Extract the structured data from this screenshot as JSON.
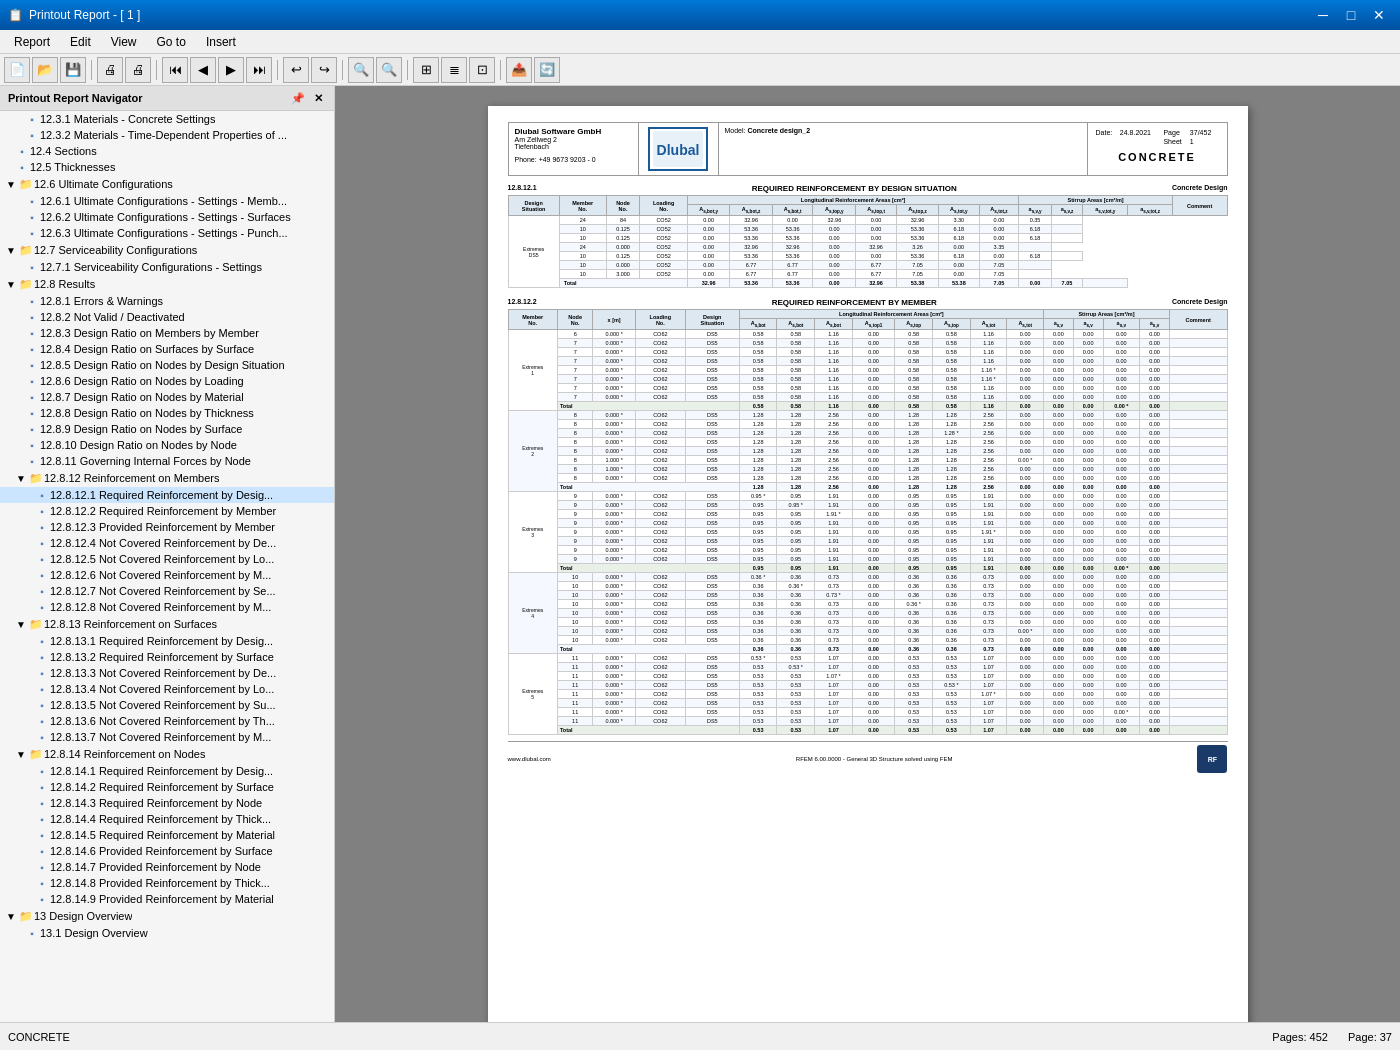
{
  "titlebar": {
    "title": "Printout Report - [ 1 ]",
    "icon": "📄"
  },
  "menubar": {
    "items": [
      "Report",
      "Edit",
      "View",
      "Go to",
      "Insert"
    ]
  },
  "toolbar": {
    "buttons": [
      {
        "name": "new",
        "icon": "📄"
      },
      {
        "name": "open",
        "icon": "📂"
      },
      {
        "name": "save",
        "icon": "💾"
      },
      {
        "name": "print",
        "icon": "🖨"
      },
      {
        "name": "print2",
        "icon": "🖨"
      },
      {
        "name": "prev1",
        "icon": "◀◀"
      },
      {
        "name": "prev",
        "icon": "◀"
      },
      {
        "name": "next",
        "icon": "▶"
      },
      {
        "name": "next1",
        "icon": "▶▶"
      },
      {
        "name": "back",
        "icon": "↩"
      },
      {
        "name": "forward",
        "icon": "↪"
      },
      {
        "name": "zoom-out",
        "icon": "🔍"
      },
      {
        "name": "zoom-in",
        "icon": "🔍"
      },
      {
        "name": "fit",
        "icon": "⊞"
      },
      {
        "name": "fit2",
        "icon": "≣"
      },
      {
        "name": "select",
        "icon": "⊡"
      },
      {
        "name": "export",
        "icon": "📤"
      },
      {
        "name": "refresh",
        "icon": "🔄"
      }
    ]
  },
  "sidebar": {
    "title": "Printout Report Navigator",
    "items": [
      {
        "id": "1231",
        "label": "12.3.1 Materials - Concrete Settings",
        "level": 2,
        "type": "doc"
      },
      {
        "id": "1232",
        "label": "12.3.2 Materials - Time-Dependent Properties of ...",
        "level": 2,
        "type": "doc"
      },
      {
        "id": "124",
        "label": "12.4 Sections",
        "level": 1,
        "type": "doc"
      },
      {
        "id": "125",
        "label": "12.5 Thicknesses",
        "level": 1,
        "type": "doc"
      },
      {
        "id": "126",
        "label": "12.6 Ultimate Configurations",
        "level": 1,
        "type": "folder",
        "expanded": true
      },
      {
        "id": "1261",
        "label": "12.6.1 Ultimate Configurations - Settings - Memb...",
        "level": 2,
        "type": "doc"
      },
      {
        "id": "1262",
        "label": "12.6.2 Ultimate Configurations - Settings - Surfaces",
        "level": 2,
        "type": "doc"
      },
      {
        "id": "1263",
        "label": "12.6.3 Ultimate Configurations - Settings - Punch...",
        "level": 2,
        "type": "doc"
      },
      {
        "id": "127",
        "label": "12.7 Serviceability Configurations",
        "level": 1,
        "type": "folder",
        "expanded": true
      },
      {
        "id": "1271",
        "label": "12.7.1 Serviceability Configurations - Settings",
        "level": 2,
        "type": "doc"
      },
      {
        "id": "128",
        "label": "12.8 Results",
        "level": 1,
        "type": "folder",
        "expanded": true
      },
      {
        "id": "1281",
        "label": "12.8.1 Errors & Warnings",
        "level": 2,
        "type": "doc"
      },
      {
        "id": "1282",
        "label": "12.8.2 Not Valid / Deactivated",
        "level": 2,
        "type": "doc"
      },
      {
        "id": "1283",
        "label": "12.8.3 Design Ratio on Members by Member",
        "level": 2,
        "type": "doc"
      },
      {
        "id": "1284",
        "label": "12.8.4 Design Ratio on Surfaces by Surface",
        "level": 2,
        "type": "doc"
      },
      {
        "id": "1285",
        "label": "12.8.5 Design Ratio on Nodes by Design Situation",
        "level": 2,
        "type": "doc"
      },
      {
        "id": "1286",
        "label": "12.8.6 Design Ratio on Nodes by Loading",
        "level": 2,
        "type": "doc"
      },
      {
        "id": "1287",
        "label": "12.8.7 Design Ratio on Nodes by Material",
        "level": 2,
        "type": "doc"
      },
      {
        "id": "1288",
        "label": "12.8.8 Design Ratio on Nodes by Thickness",
        "level": 2,
        "type": "doc"
      },
      {
        "id": "1289",
        "label": "12.8.9 Design Ratio on Nodes by Surface",
        "level": 2,
        "type": "doc"
      },
      {
        "id": "12810",
        "label": "12.8.10 Design Ratio on Nodes by Node",
        "level": 2,
        "type": "doc"
      },
      {
        "id": "12811",
        "label": "12.8.11 Governing Internal Forces by Node",
        "level": 2,
        "type": "doc"
      },
      {
        "id": "1282g",
        "label": "12.8.12 Reinforcement on Members",
        "level": 2,
        "type": "folder",
        "expanded": true
      },
      {
        "id": "128121",
        "label": "12.8.12.1 Required Reinforcement by Desig...",
        "level": 3,
        "type": "doc",
        "active": true
      },
      {
        "id": "128122",
        "label": "12.8.12.2 Required Reinforcement by Member",
        "level": 3,
        "type": "doc"
      },
      {
        "id": "128123",
        "label": "12.8.12.3 Provided Reinforcement by Member",
        "level": 3,
        "type": "doc"
      },
      {
        "id": "128124",
        "label": "12.8.12.4 Not Covered Reinforcement by De...",
        "level": 3,
        "type": "doc"
      },
      {
        "id": "128125",
        "label": "12.8.12.5 Not Covered Reinforcement by Lo...",
        "level": 3,
        "type": "doc"
      },
      {
        "id": "128126",
        "label": "12.8.12.6 Not Covered Reinforcement by M...",
        "level": 3,
        "type": "doc"
      },
      {
        "id": "128127",
        "label": "12.8.12.7 Not Covered Reinforcement by Se...",
        "level": 3,
        "type": "doc"
      },
      {
        "id": "128128",
        "label": "12.8.12.8 Not Covered Reinforcement by M...",
        "level": 3,
        "type": "doc"
      },
      {
        "id": "12813g",
        "label": "12.8.13 Reinforcement on Surfaces",
        "level": 2,
        "type": "folder",
        "expanded": true
      },
      {
        "id": "128131",
        "label": "12.8.13.1 Required Reinforcement by Desig...",
        "level": 3,
        "type": "doc"
      },
      {
        "id": "128132",
        "label": "12.8.13.2 Required Reinforcement by Surface",
        "level": 3,
        "type": "doc"
      },
      {
        "id": "128133",
        "label": "12.8.13.3 Not Covered Reinforcement by De...",
        "level": 3,
        "type": "doc"
      },
      {
        "id": "128134",
        "label": "12.8.13.4 Not Covered Reinforcement by Lo...",
        "level": 3,
        "type": "doc"
      },
      {
        "id": "128135",
        "label": "12.8.13.5 Not Covered Reinforcement by Su...",
        "level": 3,
        "type": "doc"
      },
      {
        "id": "128136",
        "label": "12.8.13.6 Not Covered Reinforcement by Th...",
        "level": 3,
        "type": "doc"
      },
      {
        "id": "128137",
        "label": "12.8.13.7 Not Covered Reinforcement by M...",
        "level": 3,
        "type": "doc"
      },
      {
        "id": "12814g",
        "label": "12.8.14 Reinforcement on Nodes",
        "level": 2,
        "type": "folder",
        "expanded": true
      },
      {
        "id": "128141",
        "label": "12.8.14.1 Required Reinforcement by Desig...",
        "level": 3,
        "type": "doc"
      },
      {
        "id": "128142",
        "label": "12.8.14.2 Required Reinforcement by Surface",
        "level": 3,
        "type": "doc"
      },
      {
        "id": "128143",
        "label": "12.8.14.3 Required Reinforcement by Node",
        "level": 3,
        "type": "doc"
      },
      {
        "id": "128144",
        "label": "12.8.14.4 Required Reinforcement by Thick...",
        "level": 3,
        "type": "doc"
      },
      {
        "id": "128145",
        "label": "12.8.14.5 Required Reinforcement by Material",
        "level": 3,
        "type": "doc"
      },
      {
        "id": "128146",
        "label": "12.8.14.6 Provided Reinforcement by Surface",
        "level": 3,
        "type": "doc"
      },
      {
        "id": "128147",
        "label": "12.8.14.7 Provided Reinforcement by Node",
        "level": 3,
        "type": "doc"
      },
      {
        "id": "128148",
        "label": "12.8.14.8 Provided Reinforcement by Thick...",
        "level": 3,
        "type": "doc"
      },
      {
        "id": "128149",
        "label": "12.8.14.9 Provided Reinforcement by Material",
        "level": 3,
        "type": "doc"
      },
      {
        "id": "13g",
        "label": "13 Design Overview",
        "level": 1,
        "type": "folder",
        "expanded": true
      },
      {
        "id": "131",
        "label": "13.1 Design Overview",
        "level": 2,
        "type": "doc"
      }
    ]
  },
  "document": {
    "company": "Dlubal Software GmbH",
    "address": "Am Zellweg 2",
    "city": "Tiefenbach",
    "phone": "Phone: +49 9673 9203 - 0",
    "logo_text": "Dlubal",
    "model_label": "Model:",
    "model_name": "Concrete design_2",
    "date_label": "Date:",
    "date_value": "24.8.2021",
    "page_label": "Page",
    "page_value": "37/452",
    "sheet_label": "Sheet",
    "sheet_value": "1",
    "title": "CONCRETE",
    "section1": {
      "num": "12.8.12.1",
      "title": "REQUIRED REINFORCEMENT BY DESIGN SITUATION",
      "design": "Concrete Design"
    },
    "section2": {
      "num": "12.8.12.2",
      "title": "REQUIRED REINFORCEMENT BY MEMBER",
      "design": "Concrete Design"
    },
    "footer": {
      "website": "www.dlubal.com",
      "software": "RFEM 6.00.0000 - General 3D Structure solved using FEM"
    }
  },
  "statusbar": {
    "label": "CONCRETE",
    "pages": "Pages: 452",
    "page": "Page: 37"
  }
}
